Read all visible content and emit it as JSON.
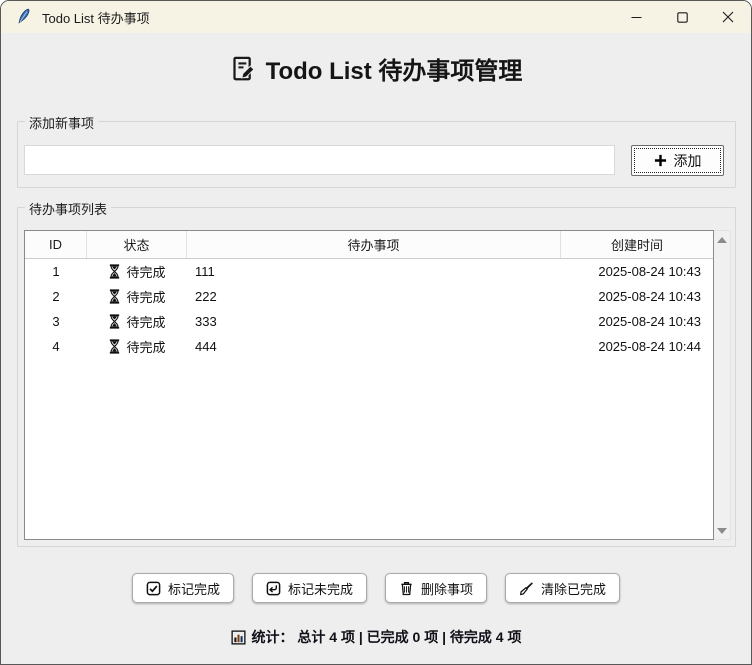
{
  "window": {
    "title": "Todo List 待办事项"
  },
  "header": {
    "title": "Todo List 待办事项管理"
  },
  "add_section": {
    "label": "添加新事项",
    "input_value": "",
    "add_button_label": "添加"
  },
  "list_section": {
    "label": "待办事项列表"
  },
  "table": {
    "columns": [
      "ID",
      "状态",
      "待办事项",
      "创建时间"
    ],
    "rows": [
      {
        "id": "1",
        "status": "待完成",
        "task": "111",
        "created": "2025-08-24 10:43"
      },
      {
        "id": "2",
        "status": "待完成",
        "task": "222",
        "created": "2025-08-24 10:43"
      },
      {
        "id": "3",
        "status": "待完成",
        "task": "333",
        "created": "2025-08-24 10:43"
      },
      {
        "id": "4",
        "status": "待完成",
        "task": "444",
        "created": "2025-08-24 10:44"
      }
    ]
  },
  "actions": {
    "mark_done": "标记完成",
    "mark_undone": "标记未完成",
    "delete": "删除事项",
    "clear_done": "清除已完成"
  },
  "stats": {
    "text": "统计： 总计 4 项 | 已完成 0 项 | 待完成 4 项",
    "total": "4",
    "completed": "0",
    "pending": "4"
  },
  "icons": {
    "titlebar": "feather-icon",
    "header": "memo-icon",
    "add": "plus-icon",
    "row_status": "hourglass-icon",
    "mark_done": "checkbox-checked-icon",
    "mark_undone": "return-arrow-icon",
    "delete": "trash-icon",
    "clear_done": "broom-icon",
    "stats": "bar-chart-icon"
  },
  "colors": {
    "titlebar_bg": "#f6f2e4",
    "window_bg": "#eeeeee",
    "tree_bg": "#ffffff",
    "feather_blue": "#3a6fb5"
  }
}
